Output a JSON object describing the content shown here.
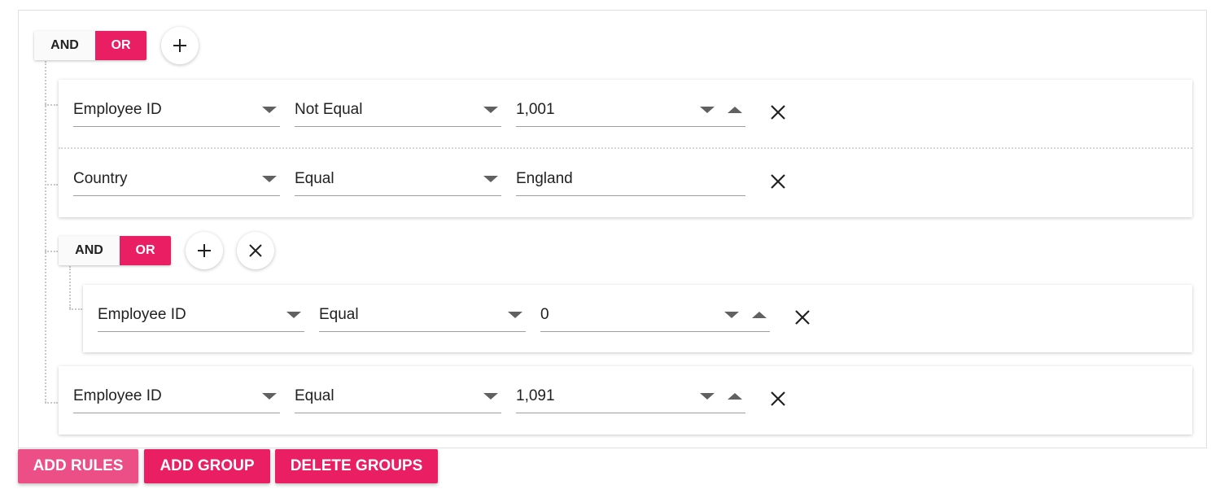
{
  "root_group": {
    "and_label": "AND",
    "or_label": "OR",
    "rules": [
      {
        "field": "Employee ID",
        "operator": "Not Equal",
        "value": "1,001",
        "numeric": true
      },
      {
        "field": "Country",
        "operator": "Equal",
        "value": "England",
        "numeric": false
      }
    ],
    "sub_group": {
      "and_label": "AND",
      "or_label": "OR",
      "rules": [
        {
          "field": "Employee ID",
          "operator": "Equal",
          "value": "0",
          "numeric": true
        }
      ]
    },
    "trailing_rule": {
      "field": "Employee ID",
      "operator": "Equal",
      "value": "1,091",
      "numeric": true
    }
  },
  "footer": {
    "add_rules": "ADD RULES",
    "add_group": "ADD GROUP",
    "delete_groups": "DELETE GROUPS"
  },
  "colors": {
    "accent": "#e91e63",
    "accent_light": "#ec4f86"
  },
  "icons": [
    "plus-icon",
    "close-icon",
    "chevron-down-icon",
    "spin-down-icon",
    "spin-up-icon"
  ]
}
